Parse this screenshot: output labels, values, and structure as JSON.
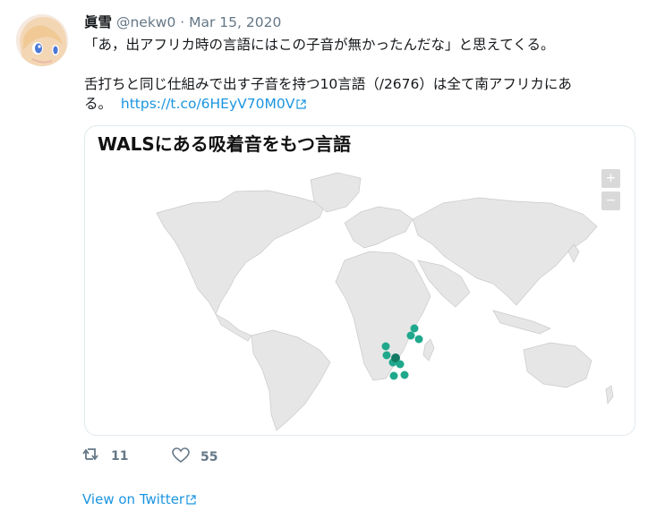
{
  "tweet": {
    "display_name": "眞雪",
    "handle": "@nekw0",
    "separator": "·",
    "date": "Mar 15, 2020",
    "text_line1": "「あ，出アフリカ時の言語にはこの子音が無かったんだな」と思えてくる。",
    "text_line2": "舌打ちと同じ仕組みで出す子音を持つ10言語（/2676）は全て南アフリカにある。",
    "link": "https://t.co/6HEyV70M0V"
  },
  "card": {
    "title": "WALSにある吸着音をもつ言語",
    "zoom_in": "+",
    "zoom_out": "−"
  },
  "actions": {
    "retweets": "11",
    "likes": "55"
  },
  "footer": {
    "view_label": "View on Twitter"
  },
  "colors": {
    "link": "#1b95e0",
    "land": "#e5e5e5",
    "marker": "#1fa88c",
    "marker_dark": "#127a62"
  }
}
